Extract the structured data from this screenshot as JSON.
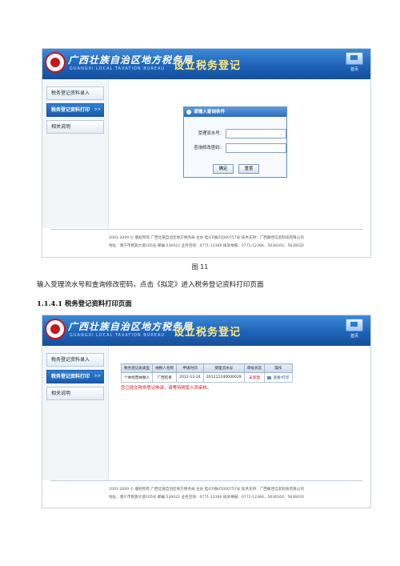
{
  "header": {
    "agency_name": "广西壮族自治区地方税务局",
    "agency_name_en": "GUANGXI LOCAL TAXATION BUREAU",
    "system_title": "设立税务登记",
    "home_label": "首页"
  },
  "sidebar": {
    "items": [
      {
        "label": "税务登记资料录入"
      },
      {
        "label": "税务登记资料打印",
        "arrow": ">>"
      },
      {
        "label": "相关说明"
      }
    ]
  },
  "footer": {
    "line1": "2001-2009 © 版权所有  广西壮族自治区地方税务局  主办  桂ICP备05000757号  技术支持：广西联佳信息科技有限公司",
    "line2": "地址：南宁市民族大道105号  邮编:530022  业务咨询：0771-12366  投诉举报：0771-12366、5636160、5636020"
  },
  "query_dialog": {
    "title": "请输入查询条件",
    "fields": [
      {
        "label": "受理流水号：",
        "value": ""
      },
      {
        "label": "查询修改密码：",
        "value": ""
      }
    ],
    "confirm_label": "确定",
    "reset_label": "重置"
  },
  "figure_caption": "图 11",
  "instruction": "输入受理流水号和查询修改密码，点击《拟定》进入税务登记资料打印页面",
  "section_heading": "1.1.4.1  税务登记资料打印页面",
  "record_table": {
    "columns": [
      "税务登记表类型",
      "纳税人名称",
      "申请时间",
      "受理流水号",
      "审核状态",
      "操作"
    ],
    "rows": [
      {
        "type": "个体经营纳税人",
        "name": "广西吃男",
        "date": "2012-12-24",
        "serial": "201212240000029",
        "status": "未受理",
        "action": "查看/打印"
      }
    ],
    "notice": "您已提交税务登记申请，请等待税管人员审核。"
  },
  "colors": {
    "banner_blue": "#1f63b8",
    "status_red": "#d51313",
    "title_yellow": "#ffe97a"
  }
}
